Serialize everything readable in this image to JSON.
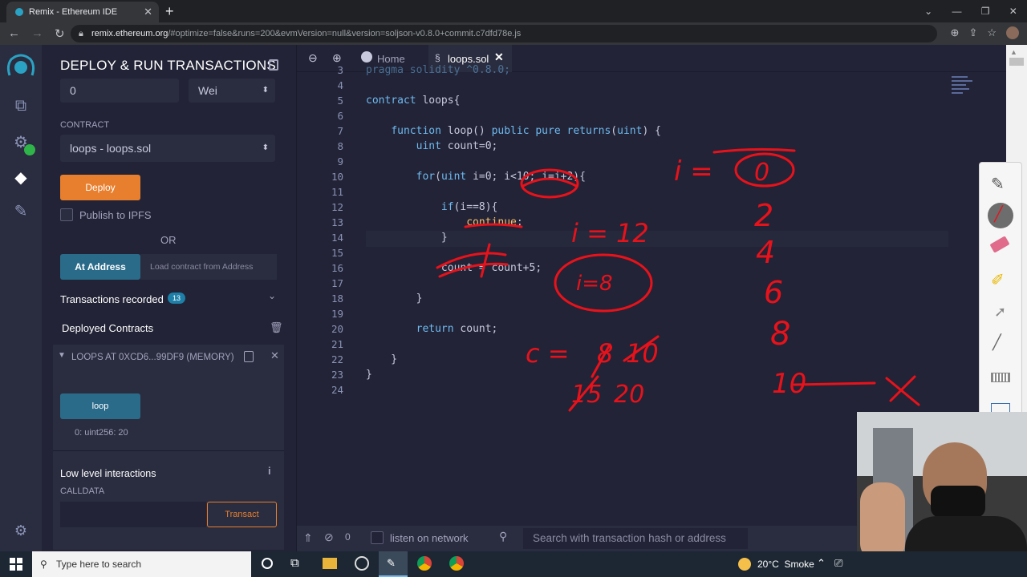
{
  "browser": {
    "tab_title": "Remix - Ethereum IDE",
    "url_host": "remix.ethereum.org",
    "url_path": "/#optimize=false&runs=200&evmVersion=null&version=soljson-v0.8.0+commit.c7dfd78e.js"
  },
  "side_panel": {
    "title": "DEPLOY & RUN TRANSACTIONS",
    "value_input": "0",
    "value_unit": "Wei",
    "contract_label": "CONTRACT",
    "contract_selected": "loops - loops.sol",
    "deploy_button": "Deploy",
    "publish_ipfs": "Publish to IPFS",
    "or_label": "OR",
    "at_address_button": "At Address",
    "load_contract_placeholder": "Load contract from Address",
    "transactions_recorded": "Transactions recorded",
    "transactions_count": "13",
    "deployed_contracts": "Deployed Contracts",
    "instance_title": "LOOPS AT 0XCD6...99DF9 (MEMORY)",
    "loop_button": "loop",
    "loop_output": "0: uint256: 20",
    "low_level": "Low level interactions",
    "calldata": "CALLDATA",
    "transact_button": "Transact"
  },
  "editor": {
    "tabs": [
      {
        "label": "Home"
      },
      {
        "label": "loops.sol"
      }
    ],
    "lines": [
      {
        "n": "3",
        "text": "pragma solidity ^0.8.0;"
      },
      {
        "n": "4",
        "text": ""
      },
      {
        "n": "5",
        "text": "contract loops{"
      },
      {
        "n": "6",
        "text": ""
      },
      {
        "n": "7",
        "text": "    function loop() public pure returns(uint) {"
      },
      {
        "n": "8",
        "text": "        uint count=0;"
      },
      {
        "n": "9",
        "text": ""
      },
      {
        "n": "10",
        "text": "        for(uint i=0; i<10; i=i+2){"
      },
      {
        "n": "11",
        "text": ""
      },
      {
        "n": "12",
        "text": "            if(i==8){"
      },
      {
        "n": "13",
        "text": "                continue;"
      },
      {
        "n": "14",
        "text": "            }"
      },
      {
        "n": "15",
        "text": ""
      },
      {
        "n": "16",
        "text": "            count = count+5;"
      },
      {
        "n": "17",
        "text": ""
      },
      {
        "n": "18",
        "text": "        }"
      },
      {
        "n": "19",
        "text": ""
      },
      {
        "n": "20",
        "text": "        return count;"
      },
      {
        "n": "21",
        "text": ""
      },
      {
        "n": "22",
        "text": "    }"
      },
      {
        "n": "23",
        "text": "}"
      },
      {
        "n": "24",
        "text": ""
      }
    ]
  },
  "terminal": {
    "count": "0",
    "listen_label": "listen on network",
    "search_placeholder": "Search with transaction hash or address"
  },
  "taskbar": {
    "search_placeholder": "Type here to search",
    "weather": "20°C  Smoke"
  },
  "annotations": {
    "color": "#e8121b",
    "i_label": "i =",
    "i_values": [
      "0",
      "2",
      "4",
      "6",
      "8",
      "10"
    ],
    "c_label": "c =",
    "c_values": [
      "8",
      "10",
      "15",
      "20"
    ],
    "i_eq_note": "i = 12",
    "circle_note": "i=8"
  },
  "colors": {
    "accent_orange": "#e77f2e",
    "accent_teal": "#2b6b8a",
    "panel_bg": "#222336"
  }
}
